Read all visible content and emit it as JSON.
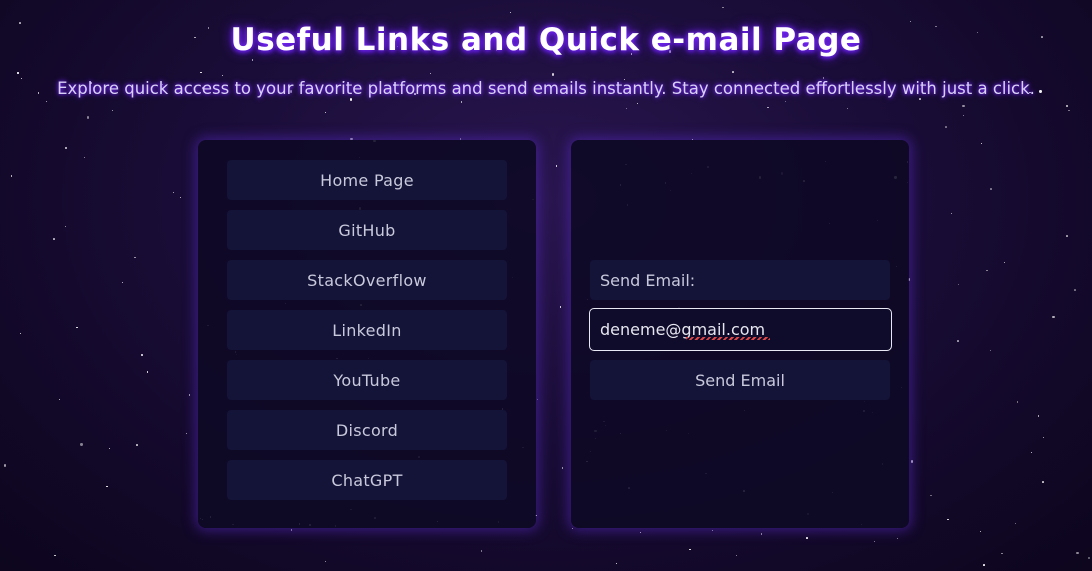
{
  "header": {
    "title": "Useful Links and Quick e-mail Page",
    "subtitle": "Explore quick access to your favorite platforms and send emails instantly. Stay connected effortlessly with just a click."
  },
  "links": [
    {
      "label": "Home Page"
    },
    {
      "label": "GitHub"
    },
    {
      "label": "StackOverflow"
    },
    {
      "label": "LinkedIn"
    },
    {
      "label": "YouTube"
    },
    {
      "label": "Discord"
    },
    {
      "label": "ChatGPT"
    }
  ],
  "email": {
    "label": "Send Email:",
    "value": "deneme@gmail.com",
    "button_label": "Send Email"
  },
  "colors": {
    "background": "#1a0d38",
    "panel": "#0e0924",
    "button": "#141338",
    "title_glow": "#7b2cff"
  }
}
